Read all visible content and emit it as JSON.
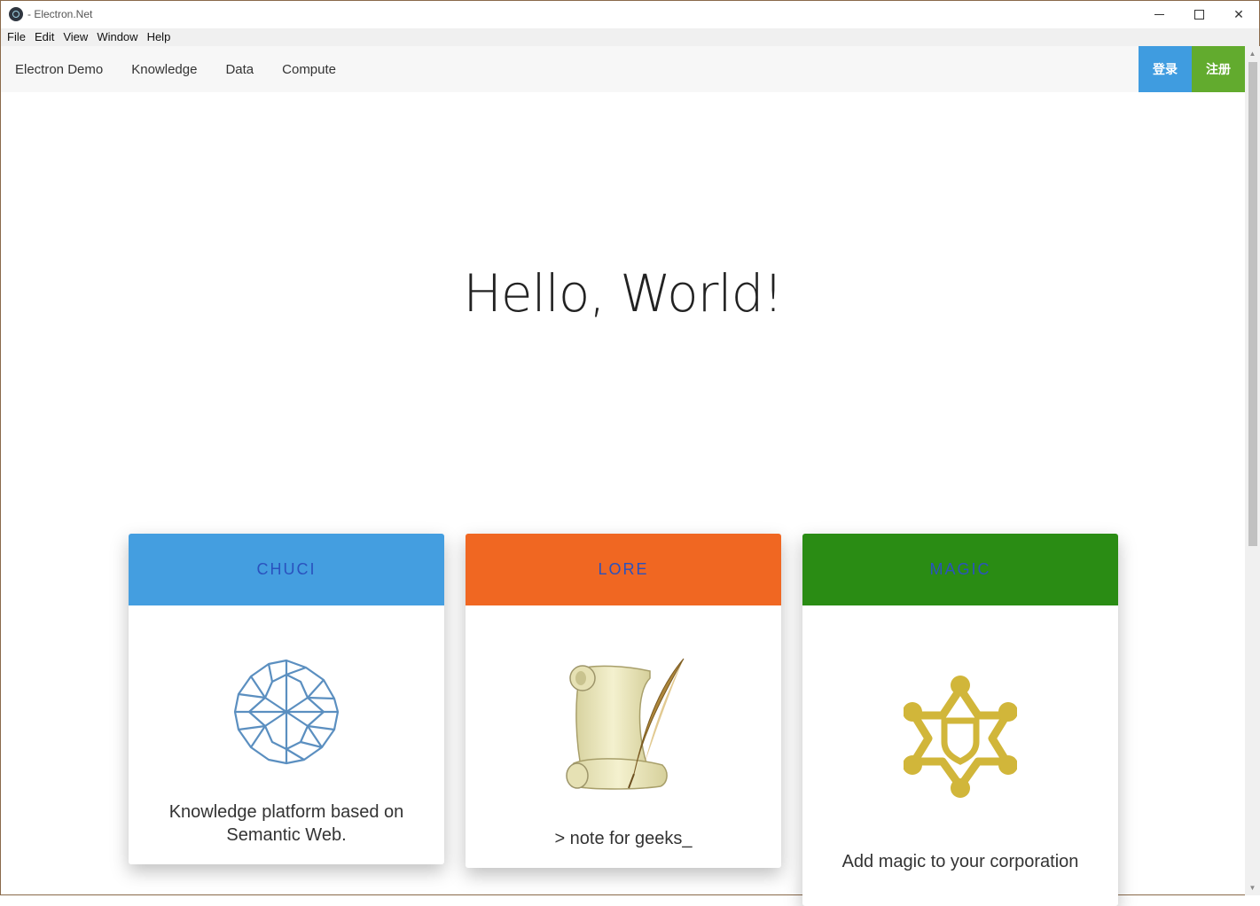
{
  "window": {
    "title": "- Electron.Net",
    "controls": {
      "minimize": "minimize-icon",
      "maximize": "maximize-icon",
      "close": "✕"
    }
  },
  "menubar": {
    "items": [
      "File",
      "Edit",
      "View",
      "Window",
      "Help"
    ]
  },
  "nav": {
    "links": [
      "Electron Demo",
      "Knowledge",
      "Data",
      "Compute"
    ],
    "login_label": "登录",
    "register_label": "注册",
    "colors": {
      "login": "#3f9ce0",
      "register": "#62ab2e"
    }
  },
  "hero": {
    "heading": "Hello, World!"
  },
  "cards": [
    {
      "title": "CHUCI",
      "text": "Knowledge platform based on Semantic Web.",
      "color": "#449ee0",
      "icon": "rosette-icon"
    },
    {
      "title": "LORE",
      "text": "> note for geeks_",
      "color": "#f06722",
      "icon": "scroll-quill-icon"
    },
    {
      "title": "MAGIC",
      "text": "Add magic to your corporation",
      "color": "#2a8c14",
      "icon": "star-shield-icon"
    }
  ]
}
